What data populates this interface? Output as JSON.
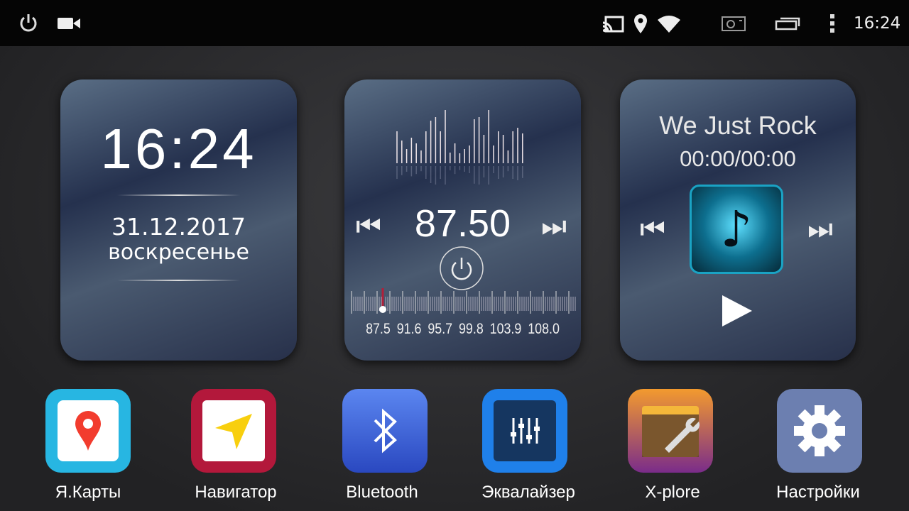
{
  "status_bar": {
    "time": "16:24",
    "icons": [
      "power-icon",
      "video-camera-icon",
      "cast-icon",
      "location-icon",
      "wifi-icon",
      "screenshot-icon",
      "recent-apps-icon",
      "more-vert-icon"
    ]
  },
  "clock_widget": {
    "time": "16:24",
    "date": "31.12.2017",
    "weekday": "воскресенье"
  },
  "radio_widget": {
    "frequency": "87.50",
    "scale_labels": [
      "87.5",
      "91.6",
      "95.7",
      "99.8",
      "103.9",
      "108.0"
    ],
    "tuner_position": 87.5,
    "scale_min": 87.5,
    "scale_max": 108.0
  },
  "music_widget": {
    "title": "We Just Rock",
    "time": "00:00/00:00"
  },
  "apps": [
    {
      "label": "Я.Карты",
      "color": "#23b4e0"
    },
    {
      "label": "Навигатор",
      "color": "#b0173a"
    },
    {
      "label": "Bluetooth",
      "color": "#3a63d6"
    },
    {
      "label": "Эквалайзер",
      "color": "#1f7ee8"
    },
    {
      "label": "X-plore",
      "color": "#e8822a"
    },
    {
      "label": "Настройки",
      "color": "#6a7fb0"
    }
  ]
}
